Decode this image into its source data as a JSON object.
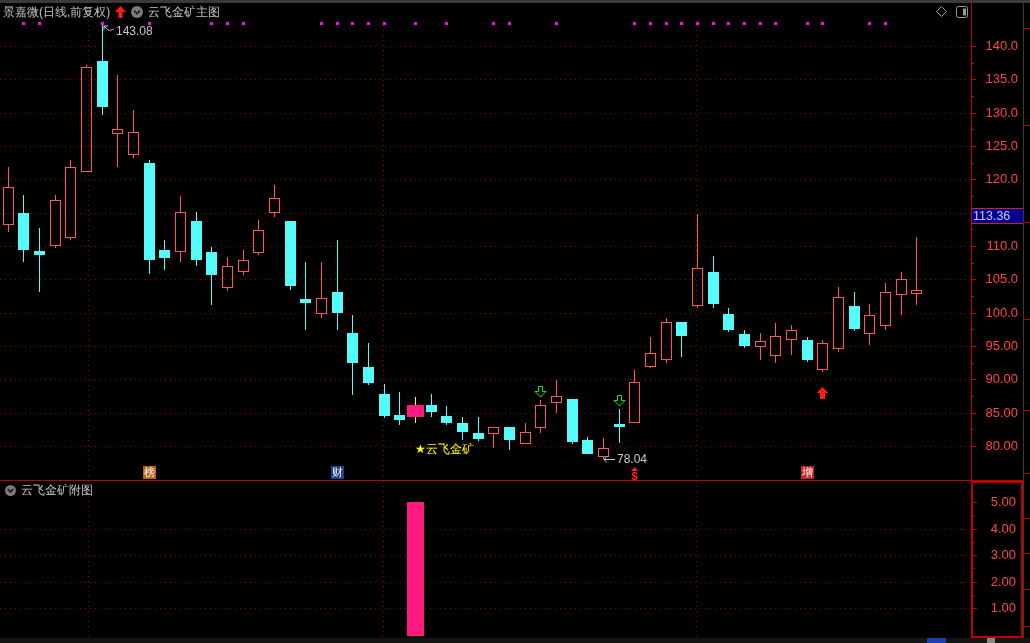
{
  "main_chart": {
    "title": "景嘉微(日线,前复权)",
    "indicator": "云飞金矿主图",
    "chart_data": {
      "type": "candlestick",
      "grid": true,
      "categories": [
        null,
        null,
        null,
        null,
        null,
        null,
        null,
        null,
        null,
        null,
        null,
        null,
        null,
        null,
        null,
        null,
        null,
        null,
        null,
        null,
        null,
        null,
        null,
        null,
        null,
        null,
        null,
        null,
        null,
        null,
        null,
        null,
        null,
        null,
        null,
        null,
        null,
        null,
        null,
        null,
        null,
        null,
        null,
        null,
        null,
        null,
        null,
        null,
        null,
        null,
        null,
        null,
        null,
        null,
        null,
        null,
        null,
        null,
        null,
        null,
        null,
        null
      ],
      "ohlc": [
        [
          113.15,
          121.85,
          112.1,
          118.85
        ],
        [
          114.95,
          117.65,
          107.6,
          109.4
        ],
        [
          109.25,
          112.7,
          103.1,
          108.65
        ],
        [
          110.0,
          117.65,
          109.7,
          116.9
        ],
        [
          111.2,
          122.9,
          110.9,
          121.85
        ],
        [
          121.1,
          137.15,
          121.1,
          136.85
        ],
        [
          137.75,
          143.08,
          129.65,
          130.85
        ],
        [
          126.8,
          135.65,
          121.85,
          127.55
        ],
        [
          123.65,
          130.4,
          123.2,
          127.1
        ],
        [
          122.45,
          122.9,
          105.8,
          107.9
        ],
        [
          109.4,
          110.9,
          106.4,
          108.2
        ],
        [
          109.1,
          117.5,
          107.6,
          115.1
        ],
        [
          113.75,
          115.1,
          107.0,
          107.9
        ],
        [
          109.1,
          109.85,
          101.15,
          105.65
        ],
        [
          103.7,
          108.35,
          103.25,
          107.0
        ],
        [
          106.1,
          109.4,
          105.65,
          107.9
        ],
        [
          108.95,
          113.9,
          108.65,
          112.4
        ],
        [
          114.95,
          119.15,
          114.35,
          117.2
        ],
        [
          113.75,
          113.75,
          103.4,
          104.0
        ],
        [
          102.05,
          107.6,
          97.4,
          101.45
        ],
        [
          99.8,
          107.6,
          99.2,
          102.2
        ],
        [
          103.1,
          110.9,
          97.4,
          99.95
        ],
        [
          96.95,
          99.65,
          87.65,
          92.45
        ],
        [
          91.85,
          95.45,
          89.15,
          89.45
        ],
        [
          87.8,
          89.3,
          84.2,
          84.5
        ],
        [
          84.65,
          88.1,
          83.15,
          83.9
        ],
        null,
        [
          86.15,
          87.8,
          84.35,
          85.1
        ],
        [
          84.5,
          86.0,
          83.15,
          83.45
        ],
        [
          83.45,
          84.35,
          80.9,
          82.1
        ],
        [
          81.95,
          84.35,
          80.75,
          81.05
        ],
        [
          81.8,
          82.85,
          79.7,
          82.85
        ],
        [
          82.85,
          82.85,
          79.4,
          80.9
        ],
        [
          80.3,
          83.45,
          80.3,
          82.1
        ],
        [
          82.7,
          86.9,
          81.95,
          86.15
        ],
        [
          86.45,
          89.9,
          84.95,
          87.5
        ],
        [
          87.05,
          87.05,
          80.3,
          80.6
        ],
        [
          80.9,
          81.35,
          78.8,
          78.8
        ],
        [
          78.3,
          81.2,
          78.04,
          79.7
        ],
        [
          83.3,
          85.55,
          80.45,
          82.85
        ],
        [
          83.45,
          91.4,
          83.45,
          89.6
        ],
        [
          91.85,
          96.35,
          91.7,
          93.95
        ],
        [
          92.9,
          99.2,
          92.45,
          98.6
        ],
        [
          98.6,
          98.6,
          93.35,
          96.5
        ],
        [
          101.0,
          114.8,
          100.7,
          106.7
        ],
        [
          106.1,
          108.5,
          100.7,
          101.3
        ],
        [
          99.8,
          100.7,
          97.1,
          97.4
        ],
        [
          96.8,
          97.4,
          94.7,
          95.0
        ],
        [
          94.85,
          96.95,
          92.9,
          95.75
        ],
        [
          93.5,
          98.45,
          92.45,
          96.5
        ],
        [
          95.9,
          98.15,
          93.65,
          97.4
        ],
        [
          95.9,
          96.35,
          92.6,
          92.9
        ],
        [
          91.4,
          95.9,
          91.1,
          95.45
        ],
        [
          94.55,
          103.85,
          94.1,
          102.35
        ],
        [
          101.0,
          103.1,
          97.25,
          97.55
        ],
        [
          96.8,
          101.3,
          95.15,
          99.65
        ],
        [
          98.0,
          104.45,
          97.4,
          103.1
        ],
        [
          102.65,
          106.1,
          99.65,
          105.05
        ],
        [
          102.8,
          111.35,
          101.15,
          103.4
        ],
        null,
        null,
        null
      ],
      "ylim": [
        74.9,
        143.9
      ],
      "yticks": [
        {
          "value": 140,
          "label": "140.0"
        },
        {
          "value": 135,
          "label": "135.0"
        },
        {
          "value": 130,
          "label": "130.0"
        },
        {
          "value": 125,
          "label": "125.0"
        },
        {
          "value": 120,
          "label": "120.0"
        },
        {
          "value": 110,
          "label": "110.0"
        },
        {
          "value": 105,
          "label": "105.0"
        },
        {
          "value": 100,
          "label": "100.0"
        },
        {
          "value": 95,
          "label": "95.00"
        },
        {
          "value": 90,
          "label": "90.00"
        },
        {
          "value": 85,
          "label": "85.00"
        },
        {
          "value": 80,
          "label": "80.00"
        }
      ],
      "annotations": [
        "143.08",
        "78.04"
      ]
    },
    "signal_label": "★云飞金矿",
    "event_markers": [
      {
        "label": "榜",
        "kind": "badge",
        "color": "#b86418"
      },
      {
        "label": "财",
        "kind": "badge",
        "color": "#1f3f8f"
      },
      {
        "label": "$",
        "kind": "arrow",
        "color": "#ff2020"
      },
      {
        "label": "增",
        "kind": "badge",
        "color": "#c42424"
      }
    ],
    "current_price": "113.36"
  },
  "sub_chart": {
    "title": "云飞金矿附图",
    "value_axis": [
      "5.00",
      "4.00",
      "3.00",
      "2.00",
      "1.00"
    ]
  }
}
